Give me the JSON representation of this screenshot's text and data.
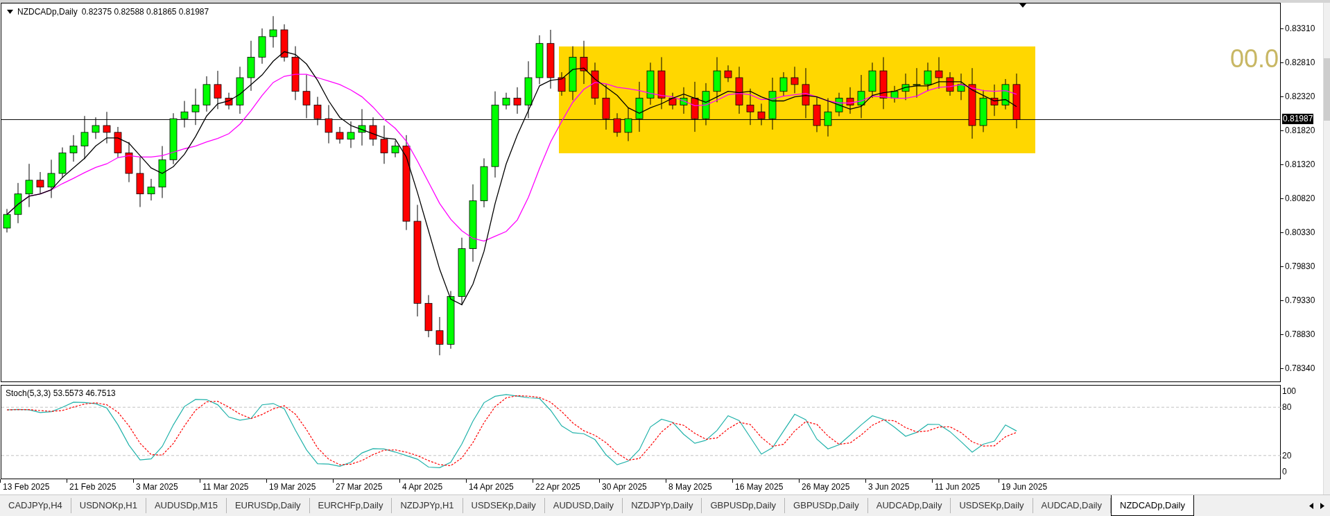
{
  "chart": {
    "symbol": "NZDCADp,Daily",
    "ohlc": "0.82375 0.82588 0.81865 0.81987",
    "overlay_label": "00.0",
    "price_axis": [
      "0.83310",
      "0.82810",
      "0.82320",
      "0.81820",
      "0.81320",
      "0.80820",
      "0.80330",
      "0.79830",
      "0.79330",
      "0.78830",
      "0.78340"
    ],
    "current_price": "0.81987",
    "indicator": {
      "label": "Stoch(5,3,3) 53.5573 46.7513",
      "levels": [
        "100",
        "80",
        "20",
        "0"
      ]
    },
    "dates": [
      "13 Feb 2025",
      "21 Feb 2025",
      "3 Mar 2025",
      "11 Mar 2025",
      "19 Mar 2025",
      "27 Mar 2025",
      "4 Apr 2025",
      "14 Apr 2025",
      "22 Apr 2025",
      "30 Apr 2025",
      "8 May 2025",
      "16 May 2025",
      "26 May 2025",
      "3 Jun 2025",
      "11 Jun 2025",
      "19 Jun 2025"
    ]
  },
  "tabs": [
    {
      "label": "CADJPYp,H4",
      "selected": false
    },
    {
      "label": "USDNOKp,H1",
      "selected": false
    },
    {
      "label": "AUDUSDp,M15",
      "selected": false
    },
    {
      "label": "EURUSDp,Daily",
      "selected": false
    },
    {
      "label": "EURCHFp,Daily",
      "selected": false
    },
    {
      "label": "NZDJPYp,H1",
      "selected": false
    },
    {
      "label": "USDSEKp,Daily",
      "selected": false
    },
    {
      "label": "AUDUSD,Daily",
      "selected": false
    },
    {
      "label": "NZDJPYp,Daily",
      "selected": false
    },
    {
      "label": "GBPUSDp,Daily",
      "selected": false
    },
    {
      "label": "GBPUSDp,Daily",
      "selected": false
    },
    {
      "label": "AUDCADp,Daily",
      "selected": false
    },
    {
      "label": "USDSEKp,Daily",
      "selected": false
    },
    {
      "label": "AUDCAD,Daily",
      "selected": false
    },
    {
      "label": "NZDCADp,Daily",
      "selected": true
    }
  ]
}
